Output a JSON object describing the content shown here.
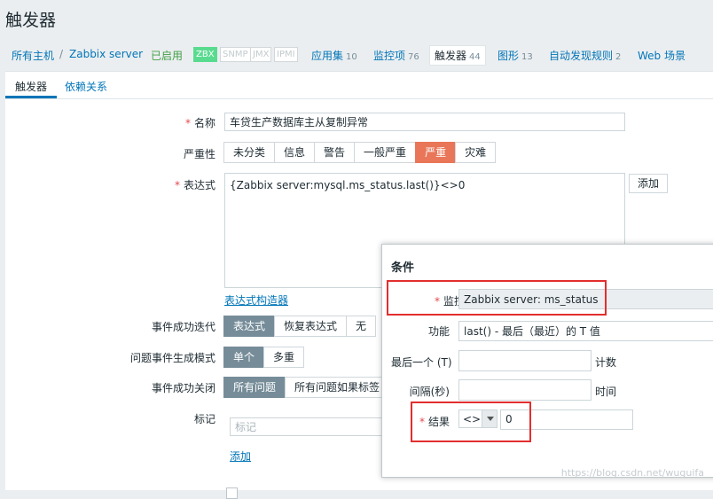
{
  "page_title": "触发器",
  "topnav": {
    "all_hosts": "所有主机",
    "separator": "/",
    "host": "Zabbix server",
    "status": "已启用",
    "badges": {
      "zbx": "ZBX",
      "snmp": "SNMP",
      "jmx": "JMX",
      "ipmi": "IPMI"
    },
    "applications": {
      "label": "应用集",
      "count": "10"
    },
    "items": {
      "label": "监控项",
      "count": "76"
    },
    "triggers": {
      "label": "触发器",
      "count": "44"
    },
    "graphs": {
      "label": "图形",
      "count": "13"
    },
    "discovery": {
      "label": "自动发现规则",
      "count": "2"
    },
    "web": {
      "label": "Web 场景"
    }
  },
  "subtabs": {
    "trigger": "触发器",
    "dependencies": "依赖关系"
  },
  "form": {
    "name_label": "名称",
    "name_value": "车贷生产数据库主从复制异常",
    "severity_label": "严重性",
    "severity_options": [
      "未分类",
      "信息",
      "警告",
      "一般严重",
      "严重",
      "灾难"
    ],
    "expression_label": "表达式",
    "expression_value": "{Zabbix server:mysql.ms_status.last()}<>0",
    "add_button": "添加",
    "expr_builder": "表达式构造器",
    "ok_event_label": "事件成功迭代",
    "ok_event_options": [
      "表达式",
      "恢复表达式",
      "无"
    ],
    "problem_mode_label": "问题事件生成模式",
    "problem_mode_options": [
      "单个",
      "多重"
    ],
    "ok_close_label": "事件成功关闭",
    "ok_close_options": [
      "所有问题",
      "所有问题如果标签"
    ],
    "tags_label": "标记",
    "tags_placeholder": "标记",
    "tags_add": "添加"
  },
  "popup": {
    "title": "条件",
    "item_label": "监控项",
    "item_value": "Zabbix server: ms_status",
    "function_label": "功能",
    "function_value": "last() - 最后（最近）的 T 值",
    "last_of_label": "最后一个 (T)",
    "last_of_suffix": "计数",
    "interval_label": "间隔(秒)",
    "interval_suffix": "时间",
    "result_label": "结果",
    "result_operator": "<>",
    "result_value": "0"
  },
  "watermark": "https://blog.csdn.net/wuguifa"
}
